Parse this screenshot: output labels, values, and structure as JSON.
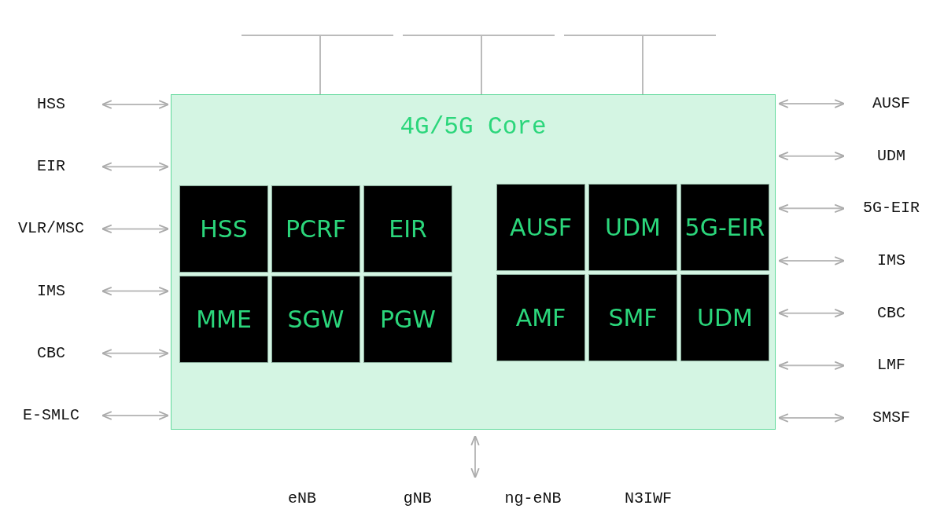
{
  "core": {
    "title": "4G/5G Core",
    "groups": [
      {
        "blocks": [
          "HSS",
          "PCRF",
          "EIR",
          "MME",
          "SGW",
          "PGW"
        ]
      },
      {
        "blocks": [
          "AUSF",
          "UDM",
          "5G-EIR",
          "AMF",
          "SMF",
          "UDM"
        ]
      }
    ]
  },
  "left_interfaces": [
    "HSS",
    "EIR",
    "VLR/MSC",
    "IMS",
    "CBC",
    "E-SMLC"
  ],
  "right_interfaces": [
    "AUSF",
    "UDM",
    "5G-EIR",
    "IMS",
    "CBC",
    "LMF",
    "SMSF"
  ],
  "access_nodes": [
    "eNB",
    "gNB",
    "ng-eNB",
    "N3IWF"
  ]
}
